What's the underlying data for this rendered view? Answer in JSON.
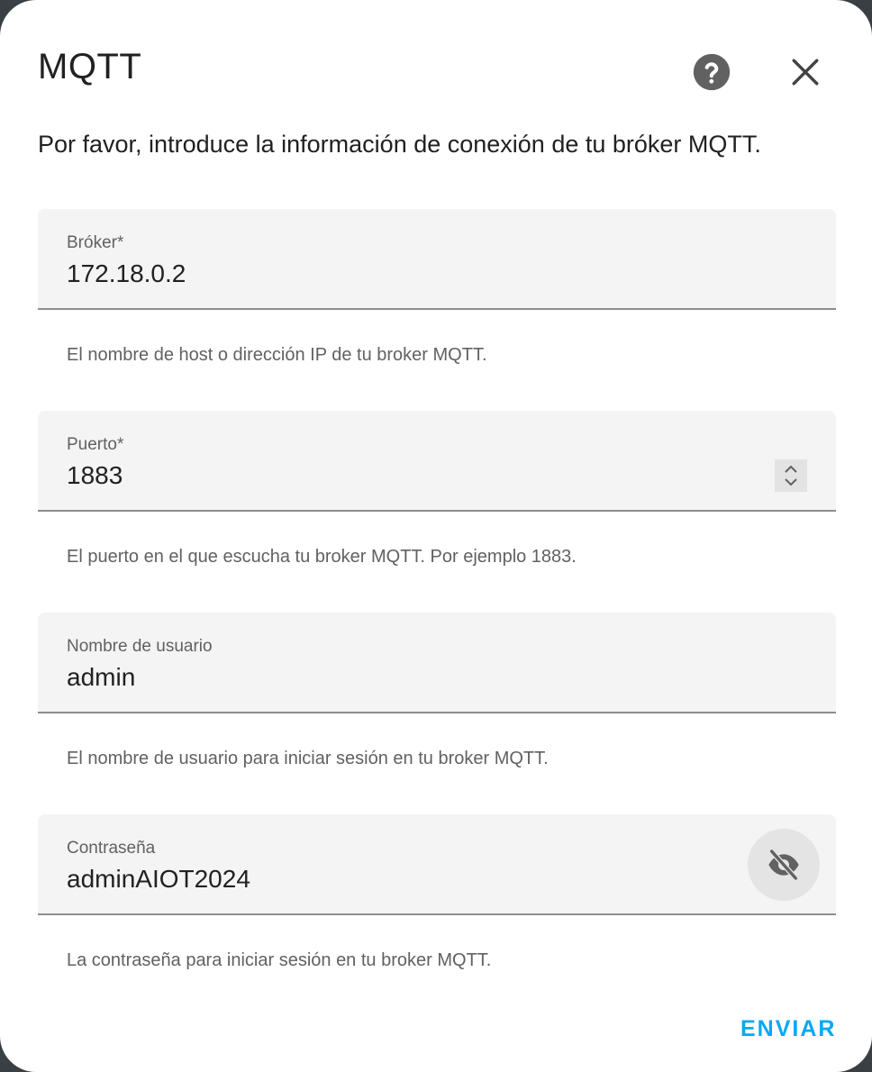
{
  "dialog": {
    "title": "MQTT",
    "description": "Por favor, introduce la información de conexión de tu bróker MQTT.",
    "help_icon": "help-circle-icon",
    "close_icon": "close-icon"
  },
  "fields": {
    "broker": {
      "label": "Bróker*",
      "value": "172.18.0.2",
      "helper": "El nombre de host o dirección IP de tu broker MQTT."
    },
    "port": {
      "label": "Puerto*",
      "value": "1883",
      "helper": "El puerto en el que escucha tu broker MQTT. Por ejemplo 1883.",
      "spinner_icon": "spinner-arrows-icon"
    },
    "username": {
      "label": "Nombre de usuario",
      "value": "admin",
      "helper": "El nombre de usuario para iniciar sesión en tu broker MQTT."
    },
    "password": {
      "label": "Contraseña",
      "value": "adminAIOT2024",
      "helper": "La contraseña para iniciar sesión en tu broker MQTT.",
      "toggle_icon": "eye-off-icon"
    }
  },
  "actions": {
    "submit_label": "ENVIAR"
  },
  "colors": {
    "accent": "#03a9f4",
    "field_bg": "#f4f4f4",
    "text": "#212121",
    "muted": "#616161"
  }
}
